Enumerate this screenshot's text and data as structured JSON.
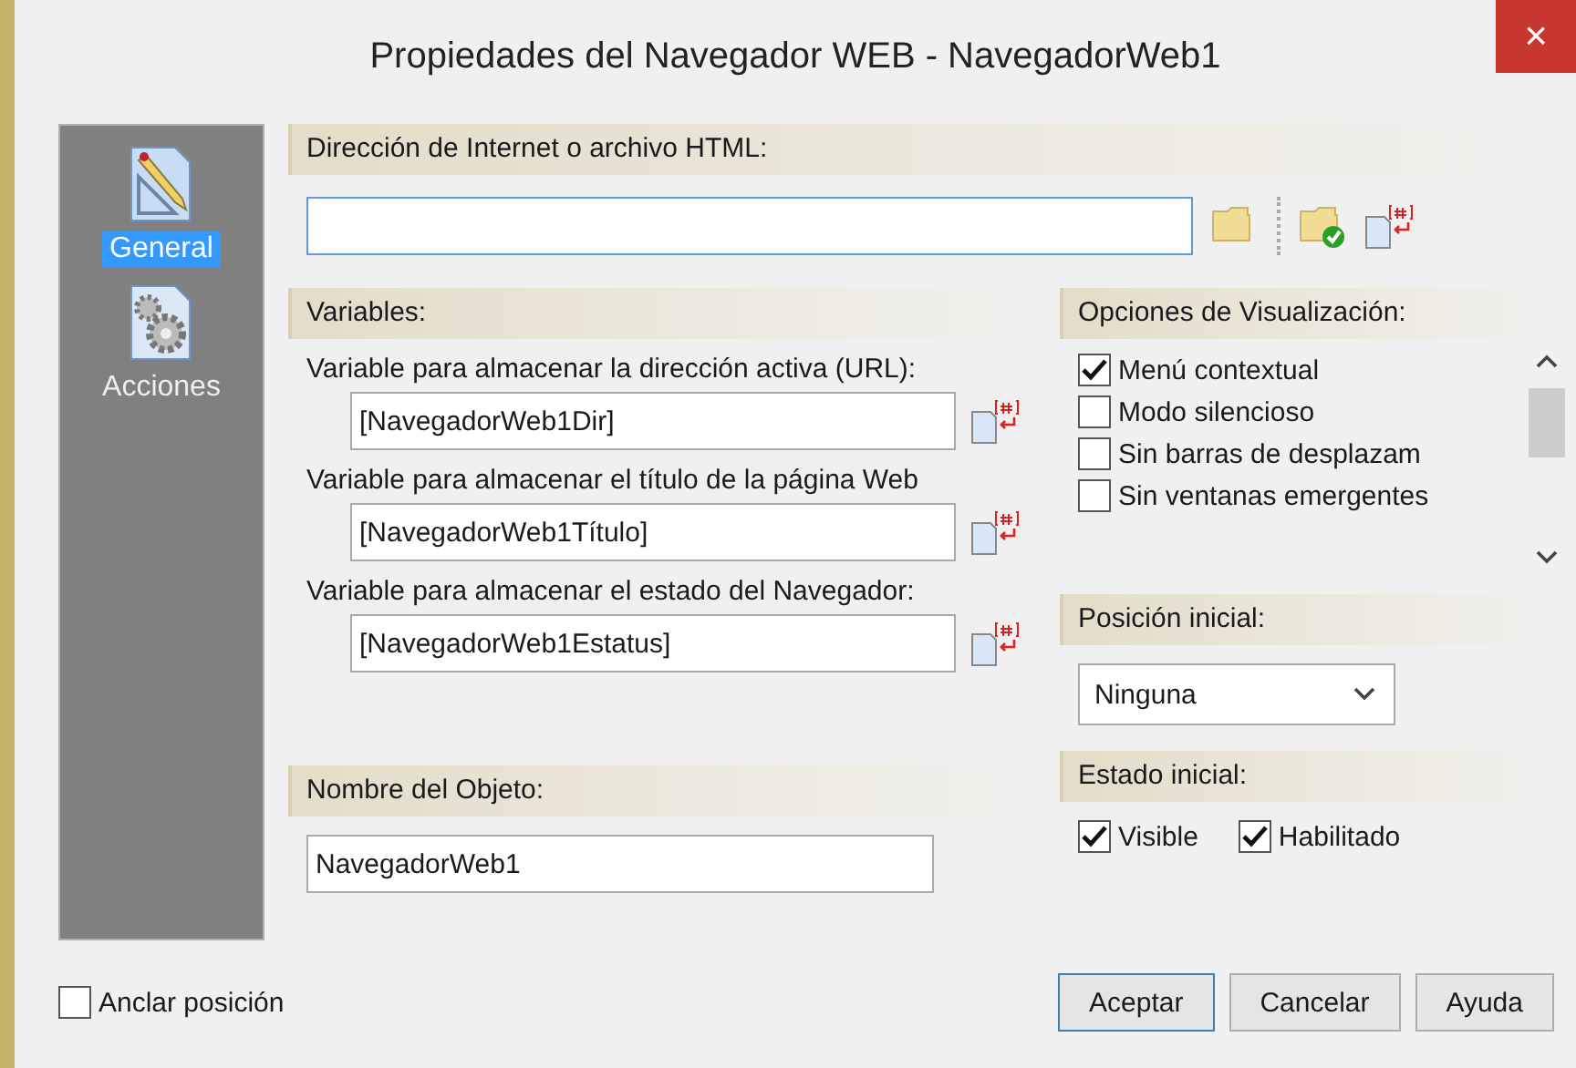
{
  "window": {
    "title": "Propiedades del Navegador WEB - NavegadorWeb1",
    "close": "×"
  },
  "sidebar": {
    "items": [
      {
        "label": "General",
        "kind": "ruler",
        "selected": true
      },
      {
        "label": "Acciones",
        "kind": "gears",
        "selected": false
      }
    ]
  },
  "address": {
    "heading": "Dirección de Internet o archivo HTML:"
  },
  "variables": {
    "heading": "Variables:",
    "fields": [
      {
        "label": "Variable para almacenar la dirección activa (URL):",
        "value": "[NavegadorWeb1Dir]"
      },
      {
        "label": "Variable para almacenar el título de la página Web",
        "value": "[NavegadorWeb1Título]"
      },
      {
        "label": "Variable para almacenar el estado del Navegador:",
        "value": "[NavegadorWeb1Estatus]"
      }
    ]
  },
  "object_name": {
    "heading": "Nombre del Objeto:",
    "value": "NavegadorWeb1"
  },
  "display_options": {
    "heading": "Opciones de Visualización:",
    "items": [
      {
        "label": "Menú contextual",
        "checked": true
      },
      {
        "label": "Modo silencioso",
        "checked": false
      },
      {
        "label": "Sin barras de desplazam",
        "checked": false
      },
      {
        "label": "Sin ventanas emergentes",
        "checked": false
      }
    ]
  },
  "initial_position": {
    "heading": "Posición inicial:",
    "value": "Ninguna"
  },
  "initial_state": {
    "heading": "Estado inicial:",
    "items": [
      {
        "label": "Visible",
        "checked": true
      },
      {
        "label": "Habilitado",
        "checked": true
      }
    ]
  },
  "anchor": {
    "label": "Anclar posición",
    "checked": false
  },
  "buttons": [
    "Aceptar",
    "Cancelar",
    "Ayuda"
  ]
}
